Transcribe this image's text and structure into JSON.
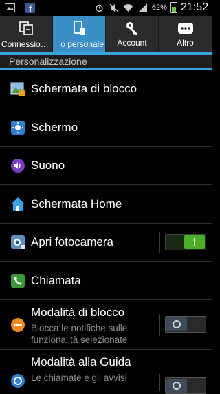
{
  "status_bar": {
    "left_icons": [
      "gallery-notification-icon",
      "facebook-notification-icon"
    ],
    "facebook_glyph": "f",
    "right_icons": [
      "alarm-icon",
      "mute-icon",
      "wifi-icon",
      "signal-icon"
    ],
    "battery_percent": "62%",
    "battery_level": 0.62,
    "time": "21:52"
  },
  "tabs": [
    {
      "label": "Connessio…",
      "icon": "connections-icon",
      "active": false
    },
    {
      "label": "o personale",
      "icon": "my-device-icon",
      "active": true
    },
    {
      "label": "Account",
      "icon": "account-key-icon",
      "active": false
    },
    {
      "label": "Altro",
      "icon": "more-icon",
      "active": false
    }
  ],
  "section_header": "Personalizzazione",
  "items": [
    {
      "title": "Schermata di blocco",
      "icon": "lock-screen-icon"
    },
    {
      "title": "Schermo",
      "icon": "display-icon"
    },
    {
      "title": "Suono",
      "icon": "sound-icon"
    },
    {
      "title": "Schermata Home",
      "icon": "home-icon"
    },
    {
      "title": "Apri fotocamera",
      "icon": "camera-icon",
      "toggle": "on"
    },
    {
      "title": "Chiamata",
      "icon": "phone-icon"
    },
    {
      "title": "Modalità di blocco",
      "subtitle": "Blocca le notifiche sulle funzionalità selezionate",
      "icon": "block-mode-icon",
      "toggle": "off"
    },
    {
      "title": "Modalità alla Guida",
      "subtitle": "Le chiamate e gli avvisi",
      "icon": "driving-mode-icon",
      "toggle": "off"
    }
  ],
  "colors": {
    "accent": "#3aa2e0",
    "active_tab": "#3b8fc7",
    "toggle_on": "#4caf2a"
  }
}
